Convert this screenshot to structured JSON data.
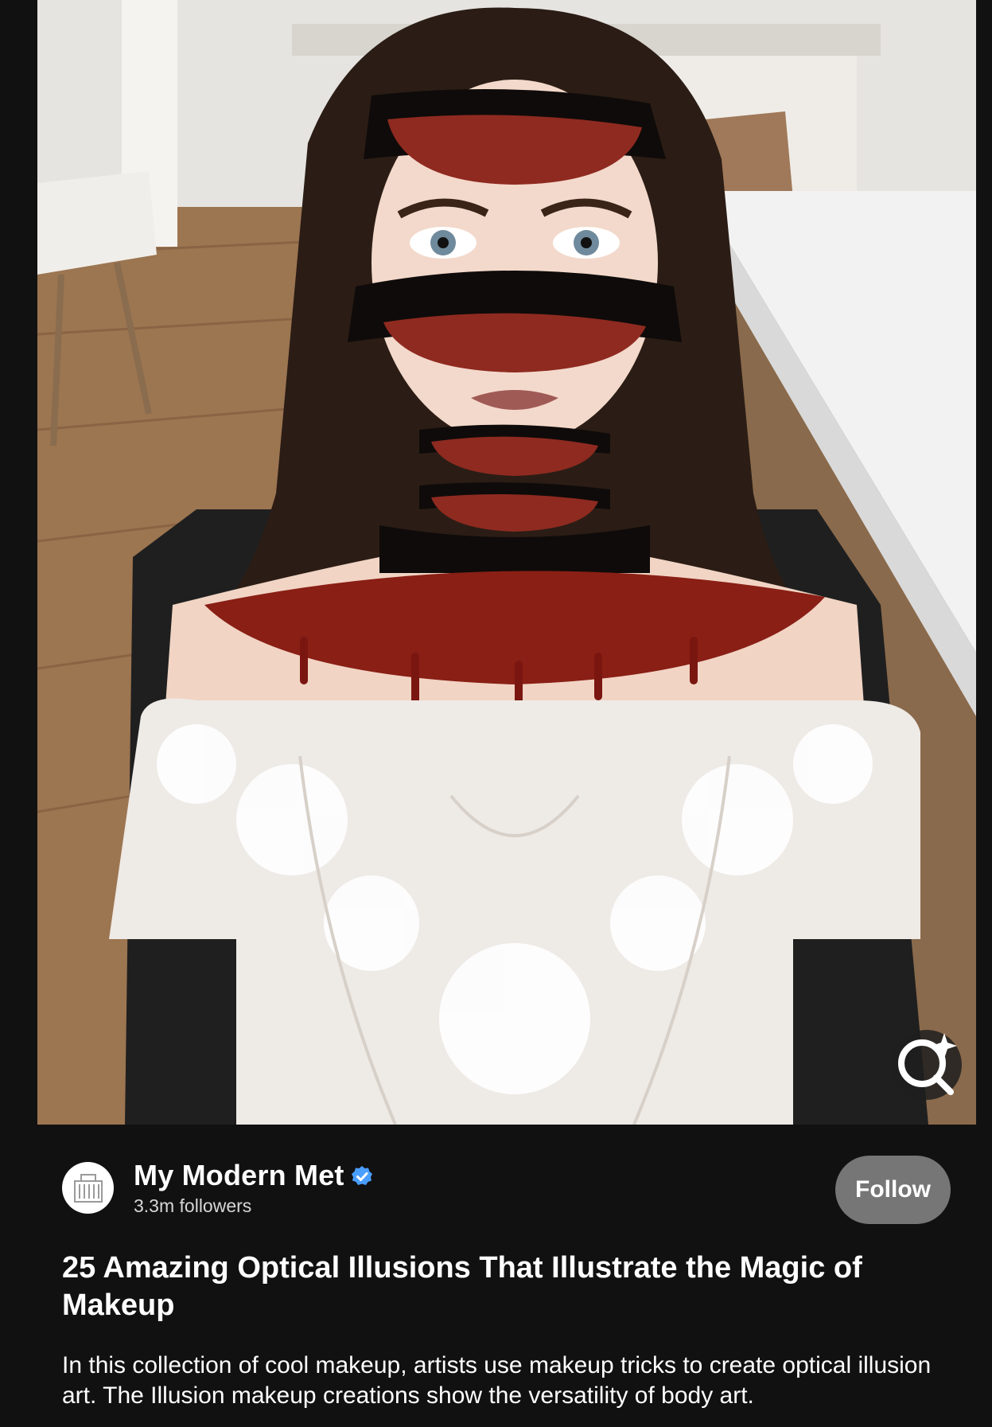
{
  "pin": {
    "image_alt": "Woman with illusion makeup of sliced face and dripping blood, wearing a white lace off-shoulder top",
    "visual_search_icon": "visual-search-icon"
  },
  "creator": {
    "name": "My Modern Met",
    "followers": "3.3m followers",
    "verified": true,
    "verified_color": "#4a9eff",
    "avatar_icon": "building-logo-icon"
  },
  "follow_button": {
    "label": "Follow",
    "color": "#767676"
  },
  "title": "25 Amazing Optical Illusions That Illustrate the Magic of Makeup",
  "description": "In this collection of cool makeup, artists use makeup tricks to create optical illusion art. The Illusion makeup creations show the versatility of body art.",
  "colors": {
    "background": "#111111",
    "text": "#ffffff"
  }
}
